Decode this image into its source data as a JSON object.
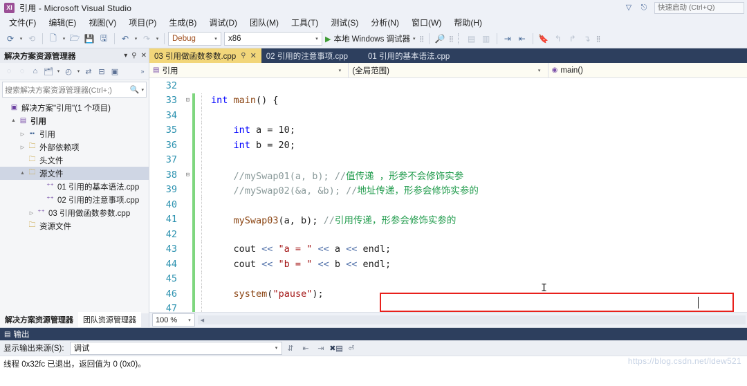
{
  "window": {
    "title": "引用 - Microsoft Visual Studio",
    "logo_text": "XI",
    "quick_launch_placeholder": "快速启动 (Ctrl+Q)",
    "title_icons": [
      "feedback-icon",
      "signin-icon"
    ]
  },
  "menubar": {
    "items": [
      {
        "label": "文件(F)"
      },
      {
        "label": "编辑(E)"
      },
      {
        "label": "视图(V)"
      },
      {
        "label": "项目(P)"
      },
      {
        "label": "生成(B)"
      },
      {
        "label": "调试(D)"
      },
      {
        "label": "团队(M)"
      },
      {
        "label": "工具(T)"
      },
      {
        "label": "测试(S)"
      },
      {
        "label": "分析(N)"
      },
      {
        "label": "窗口(W)"
      },
      {
        "label": "帮助(H)"
      }
    ]
  },
  "toolbar": {
    "config_value": "Debug",
    "platform_value": "x86",
    "run_label": "本地 Windows 调试器",
    "icons": [
      "navigate-back-icon",
      "navigate-forward-icon",
      "new-project-icon",
      "open-file-icon",
      "save-icon",
      "save-all-icon",
      "undo-icon",
      "redo-icon",
      "find-icon",
      "comment-icon",
      "uncomment-icon",
      "indent-icon",
      "outdent-icon",
      "bookmark-icon",
      "nav-prev-icon",
      "nav-next-icon",
      "nav-clear-icon"
    ]
  },
  "solution_explorer": {
    "title": "解决方案资源管理器",
    "header_icons": [
      "chevron-down-icon",
      "pin-icon",
      "close-icon"
    ],
    "toolbar_icons": [
      "back-icon",
      "forward-icon",
      "home-icon",
      "refresh-icon",
      "chevron-down-icon",
      "pending-changes-icon",
      "sync-icon",
      "collapse-all-icon",
      "properties-icon",
      "overflow-icon"
    ],
    "search_placeholder": "搜索解决方案资源管理器(Ctrl+;)",
    "tree": [
      {
        "label": "解决方案\"引用\"(1 个项目)",
        "indent": 0,
        "arrow": "",
        "icon": "solution-icon",
        "selected": false
      },
      {
        "label": "引用",
        "indent": 1,
        "arrow": "▲",
        "icon": "project-icon",
        "selected": false
      },
      {
        "label": "引用",
        "indent": 2,
        "arrow": "▷",
        "icon": "references-icon",
        "selected": false
      },
      {
        "label": "外部依赖项",
        "indent": 2,
        "arrow": "▷",
        "icon": "external-deps-icon",
        "selected": false
      },
      {
        "label": "头文件",
        "indent": 2,
        "arrow": "",
        "icon": "folder-icon",
        "selected": false
      },
      {
        "label": "源文件",
        "indent": 2,
        "arrow": "▲",
        "icon": "folder-icon",
        "selected": true
      },
      {
        "label": "01 引用的基本语法.cpp",
        "indent": 3,
        "arrow": "",
        "icon": "cpp-file-icon",
        "selected": false
      },
      {
        "label": "02 引用的注意事项.cpp",
        "indent": 3,
        "arrow": "",
        "icon": "cpp-file-icon",
        "selected": false
      },
      {
        "label": "03 引用做函数参数.cpp",
        "indent": 3,
        "arrow": "▷",
        "icon": "cpp-file-icon",
        "selected": false
      },
      {
        "label": "资源文件",
        "indent": 2,
        "arrow": "",
        "icon": "folder-icon",
        "selected": false
      }
    ],
    "bottom_tabs": [
      {
        "label": "解决方案资源管理器",
        "active": true
      },
      {
        "label": "团队资源管理器",
        "active": false
      }
    ]
  },
  "editor": {
    "tabs": [
      {
        "label": "03 引用做函数参数.cpp",
        "active": true,
        "pin": "pin-icon",
        "close": "close-icon"
      },
      {
        "label": "02 引用的注意事项.cpp",
        "active": false
      },
      {
        "label": "01 引用的基本语法.cpp",
        "active": false
      }
    ],
    "navbar": {
      "project": "引用",
      "scope": "(全局范围)",
      "member": "main()"
    },
    "lines": [
      {
        "num": "32",
        "change": false,
        "fold": "",
        "tokens": []
      },
      {
        "num": "33",
        "change": true,
        "fold": "⊟",
        "tokens": [
          {
            "t": "int ",
            "c": "kw"
          },
          {
            "t": "main",
            "c": "fn"
          },
          {
            "t": "() {",
            "c": "id"
          }
        ]
      },
      {
        "num": "34",
        "change": true,
        "fold": "",
        "tokens": []
      },
      {
        "num": "35",
        "change": true,
        "fold": "",
        "tokens": [
          {
            "t": "    ",
            "c": "id"
          },
          {
            "t": "int",
            "c": "kw"
          },
          {
            "t": " a = ",
            "c": "id"
          },
          {
            "t": "10",
            "c": "num"
          },
          {
            "t": ";",
            "c": "id"
          }
        ]
      },
      {
        "num": "36",
        "change": true,
        "fold": "",
        "tokens": [
          {
            "t": "    ",
            "c": "id"
          },
          {
            "t": "int",
            "c": "kw"
          },
          {
            "t": " b = ",
            "c": "id"
          },
          {
            "t": "20",
            "c": "num"
          },
          {
            "t": ";",
            "c": "id"
          }
        ]
      },
      {
        "num": "37",
        "change": true,
        "fold": "",
        "tokens": []
      },
      {
        "num": "38",
        "change": true,
        "fold": "⊟",
        "tokens": [
          {
            "t": "    ",
            "c": "id"
          },
          {
            "t": "//mySwap01(a, b); //",
            "c": "cmgray"
          },
          {
            "t": "值传递 ，形参不会修饰实参",
            "c": "cm"
          }
        ]
      },
      {
        "num": "39",
        "change": true,
        "fold": "",
        "tokens": [
          {
            "t": "    ",
            "c": "id"
          },
          {
            "t": "//mySwap02(&a, &b); //",
            "c": "cmgray"
          },
          {
            "t": "地址传递，形参会修饰实参的",
            "c": "cm"
          }
        ]
      },
      {
        "num": "40",
        "change": true,
        "fold": "",
        "tokens": []
      },
      {
        "num": "41",
        "change": true,
        "fold": "",
        "tokens": [
          {
            "t": "    ",
            "c": "id"
          },
          {
            "t": "mySwap03",
            "c": "fn"
          },
          {
            "t": "(a, b); ",
            "c": "id"
          },
          {
            "t": "//",
            "c": "cmgray"
          },
          {
            "t": "引用传递，形参会修饰实参的",
            "c": "cm"
          }
        ]
      },
      {
        "num": "42",
        "change": true,
        "fold": "",
        "tokens": []
      },
      {
        "num": "43",
        "change": true,
        "fold": "",
        "tokens": [
          {
            "t": "    ",
            "c": "id"
          },
          {
            "t": "cout",
            "c": "id"
          },
          {
            "t": " << ",
            "c": "op"
          },
          {
            "t": "\"a = \"",
            "c": "str"
          },
          {
            "t": " << ",
            "c": "op"
          },
          {
            "t": "a",
            "c": "id"
          },
          {
            "t": " << ",
            "c": "op"
          },
          {
            "t": "endl;",
            "c": "id"
          }
        ]
      },
      {
        "num": "44",
        "change": true,
        "fold": "",
        "tokens": [
          {
            "t": "    ",
            "c": "id"
          },
          {
            "t": "cout",
            "c": "id"
          },
          {
            "t": " << ",
            "c": "op"
          },
          {
            "t": "\"b = \"",
            "c": "str"
          },
          {
            "t": " << ",
            "c": "op"
          },
          {
            "t": "b",
            "c": "id"
          },
          {
            "t": " << ",
            "c": "op"
          },
          {
            "t": "endl;",
            "c": "id"
          }
        ]
      },
      {
        "num": "45",
        "change": true,
        "fold": "",
        "tokens": []
      },
      {
        "num": "46",
        "change": true,
        "fold": "",
        "tokens": [
          {
            "t": "    ",
            "c": "id"
          },
          {
            "t": "system",
            "c": "fn"
          },
          {
            "t": "(",
            "c": "id"
          },
          {
            "t": "\"pause\"",
            "c": "str"
          },
          {
            "t": ");",
            "c": "id"
          }
        ]
      },
      {
        "num": "47",
        "change": true,
        "fold": "",
        "tokens": []
      }
    ],
    "highlight_box_color": "#e8201c",
    "zoom_level": "100 %"
  },
  "output": {
    "title": "输出",
    "source_label": "显示输出来源(S):",
    "source_value": "调试",
    "toolbar_icons": [
      "list-icon",
      "wrap-icon",
      "clear-all-icon",
      "toggle-wordwrap-icon",
      "find-icon"
    ],
    "lines": [
      "线程 0x32fc 已退出，返回值为 0 (0x0)。"
    ]
  },
  "watermark": "https://blog.csdn.net/ldew521"
}
